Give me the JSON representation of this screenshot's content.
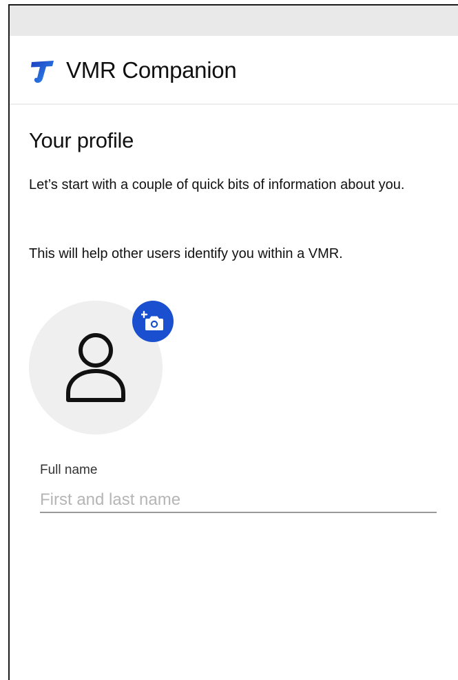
{
  "header": {
    "app_title": "VMR Companion",
    "logo_icon": "telstra-logo-icon",
    "brand_color": "#1f5fd6"
  },
  "profile": {
    "title": "Your profile",
    "intro": "Let’s start with a couple of quick bits of information about you.",
    "note": "This will help other users identify you within a VMR.",
    "avatar_icon": "person-icon",
    "camera_icon": "add-photo-camera-icon",
    "accent_color": "#1a4fcf"
  },
  "form": {
    "full_name_label": "Full name",
    "full_name_placeholder": "First and last name",
    "full_name_value": ""
  }
}
